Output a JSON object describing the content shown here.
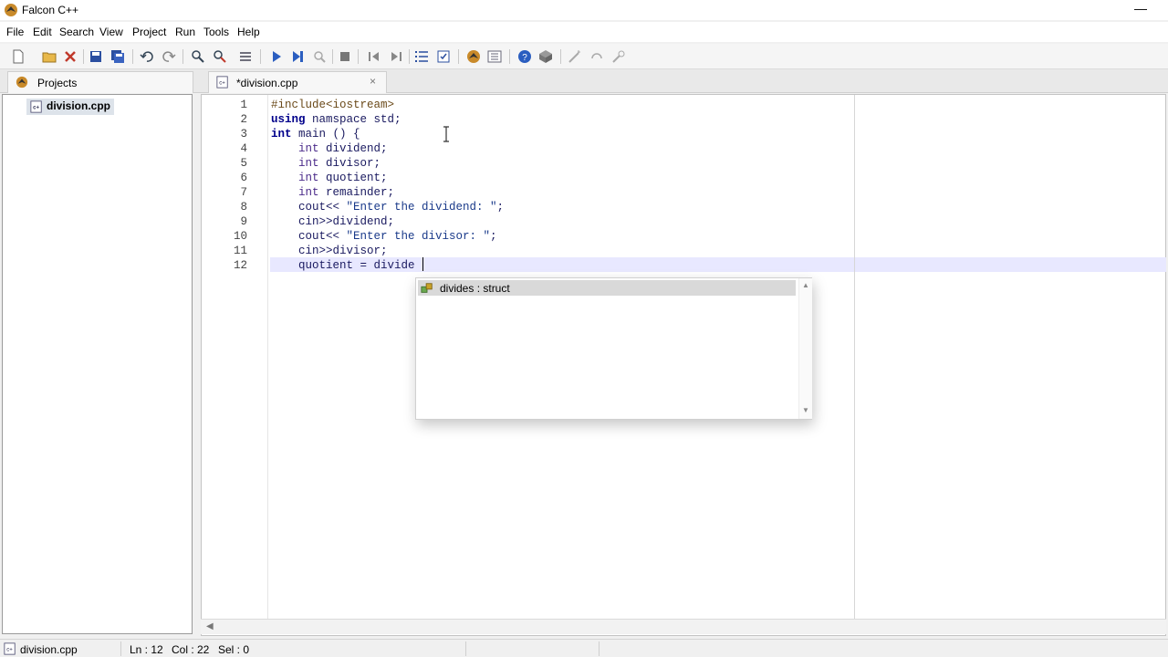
{
  "window": {
    "title": "Falcon C++",
    "minimize": "—"
  },
  "menu": [
    "File",
    "Edit",
    "Search",
    "View",
    "Project",
    "Run",
    "Tools",
    "Help"
  ],
  "toolbar": {
    "icons": [
      "new-file-icon",
      "open-folder-icon",
      "close-icon",
      "save-icon",
      "save-all-icon",
      "undo-icon",
      "redo-icon",
      "find-icon",
      "replace-icon",
      "goto-line-icon",
      "run-icon",
      "step-icon",
      "debug-icon",
      "stop-icon",
      "back-icon",
      "forward-icon",
      "list-icon",
      "checklist-icon",
      "project-icon",
      "properties-icon",
      "help-icon",
      "package-icon",
      "wand-icon",
      "tool-icon",
      "hint-icon"
    ]
  },
  "projects_tab": {
    "label": "Projects"
  },
  "editor_tab": {
    "label": "*division.cpp",
    "close": "×"
  },
  "project_tree": {
    "file": "division.cpp"
  },
  "editor": {
    "line_numbers": [
      "1",
      "2",
      "3",
      "4",
      "5",
      "6",
      "7",
      "8",
      "9",
      "10",
      "11",
      "12"
    ],
    "lines": [
      [
        {
          "t": "pp",
          "v": "#include<iostream>"
        }
      ],
      [
        {
          "t": "kw",
          "v": "using"
        },
        {
          "t": "n",
          "v": " namspace std;"
        }
      ],
      [
        {
          "t": "kw",
          "v": "int"
        },
        {
          "t": "n",
          "v": " main () {"
        }
      ],
      [
        {
          "t": "n",
          "v": "    "
        },
        {
          "t": "type",
          "v": "int"
        },
        {
          "t": "n",
          "v": " dividend;"
        }
      ],
      [
        {
          "t": "n",
          "v": "    "
        },
        {
          "t": "type",
          "v": "int"
        },
        {
          "t": "n",
          "v": " divisor;"
        }
      ],
      [
        {
          "t": "n",
          "v": "    "
        },
        {
          "t": "type",
          "v": "int"
        },
        {
          "t": "n",
          "v": " quotient;"
        }
      ],
      [
        {
          "t": "n",
          "v": "    "
        },
        {
          "t": "type",
          "v": "int"
        },
        {
          "t": "n",
          "v": " remainder;"
        }
      ],
      [
        {
          "t": "n",
          "v": "    cout<< "
        },
        {
          "t": "str",
          "v": "\"Enter the dividend: \""
        },
        {
          "t": "n",
          "v": ";"
        }
      ],
      [
        {
          "t": "n",
          "v": "    cin>>dividend;"
        }
      ],
      [
        {
          "t": "n",
          "v": "    cout<< "
        },
        {
          "t": "str",
          "v": "\"Enter the divisor: \""
        },
        {
          "t": "n",
          "v": ";"
        }
      ],
      [
        {
          "t": "n",
          "v": "    cin>>divisor;"
        }
      ],
      [
        {
          "t": "n",
          "v": "    quotient = divide"
        }
      ]
    ]
  },
  "autocomplete": {
    "item": "divides : struct"
  },
  "status": {
    "file": "division.cpp",
    "line": "Ln : 12",
    "col": "Col : 22",
    "sel": "Sel : 0"
  },
  "colors": {
    "current_line": "#e8e8ff",
    "keyword": "#00008b",
    "selection": "#d9d9d9"
  }
}
